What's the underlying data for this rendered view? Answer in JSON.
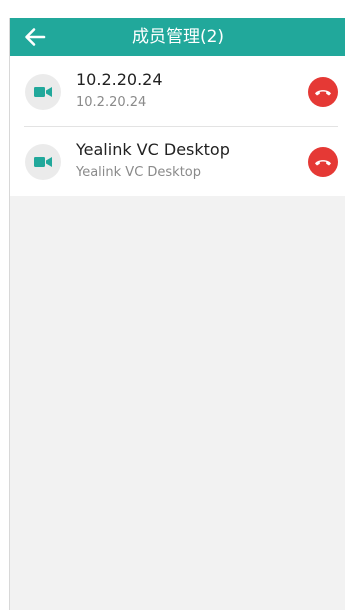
{
  "header": {
    "title": "成员管理(2)",
    "back_icon": "arrow-left-icon",
    "color": "#21a89b"
  },
  "members": [
    {
      "name": "10.2.20.24",
      "subtitle": "10.2.20.24",
      "avatar_icon": "video-camera-icon",
      "action_icon": "hang-up-icon"
    },
    {
      "name": "Yealink VC Desktop",
      "subtitle": "Yealink VC Desktop",
      "avatar_icon": "video-camera-icon",
      "action_icon": "hang-up-icon"
    }
  ],
  "colors": {
    "accent": "#21a89b",
    "hangup": "#e53935",
    "background": "#f2f2f2"
  }
}
